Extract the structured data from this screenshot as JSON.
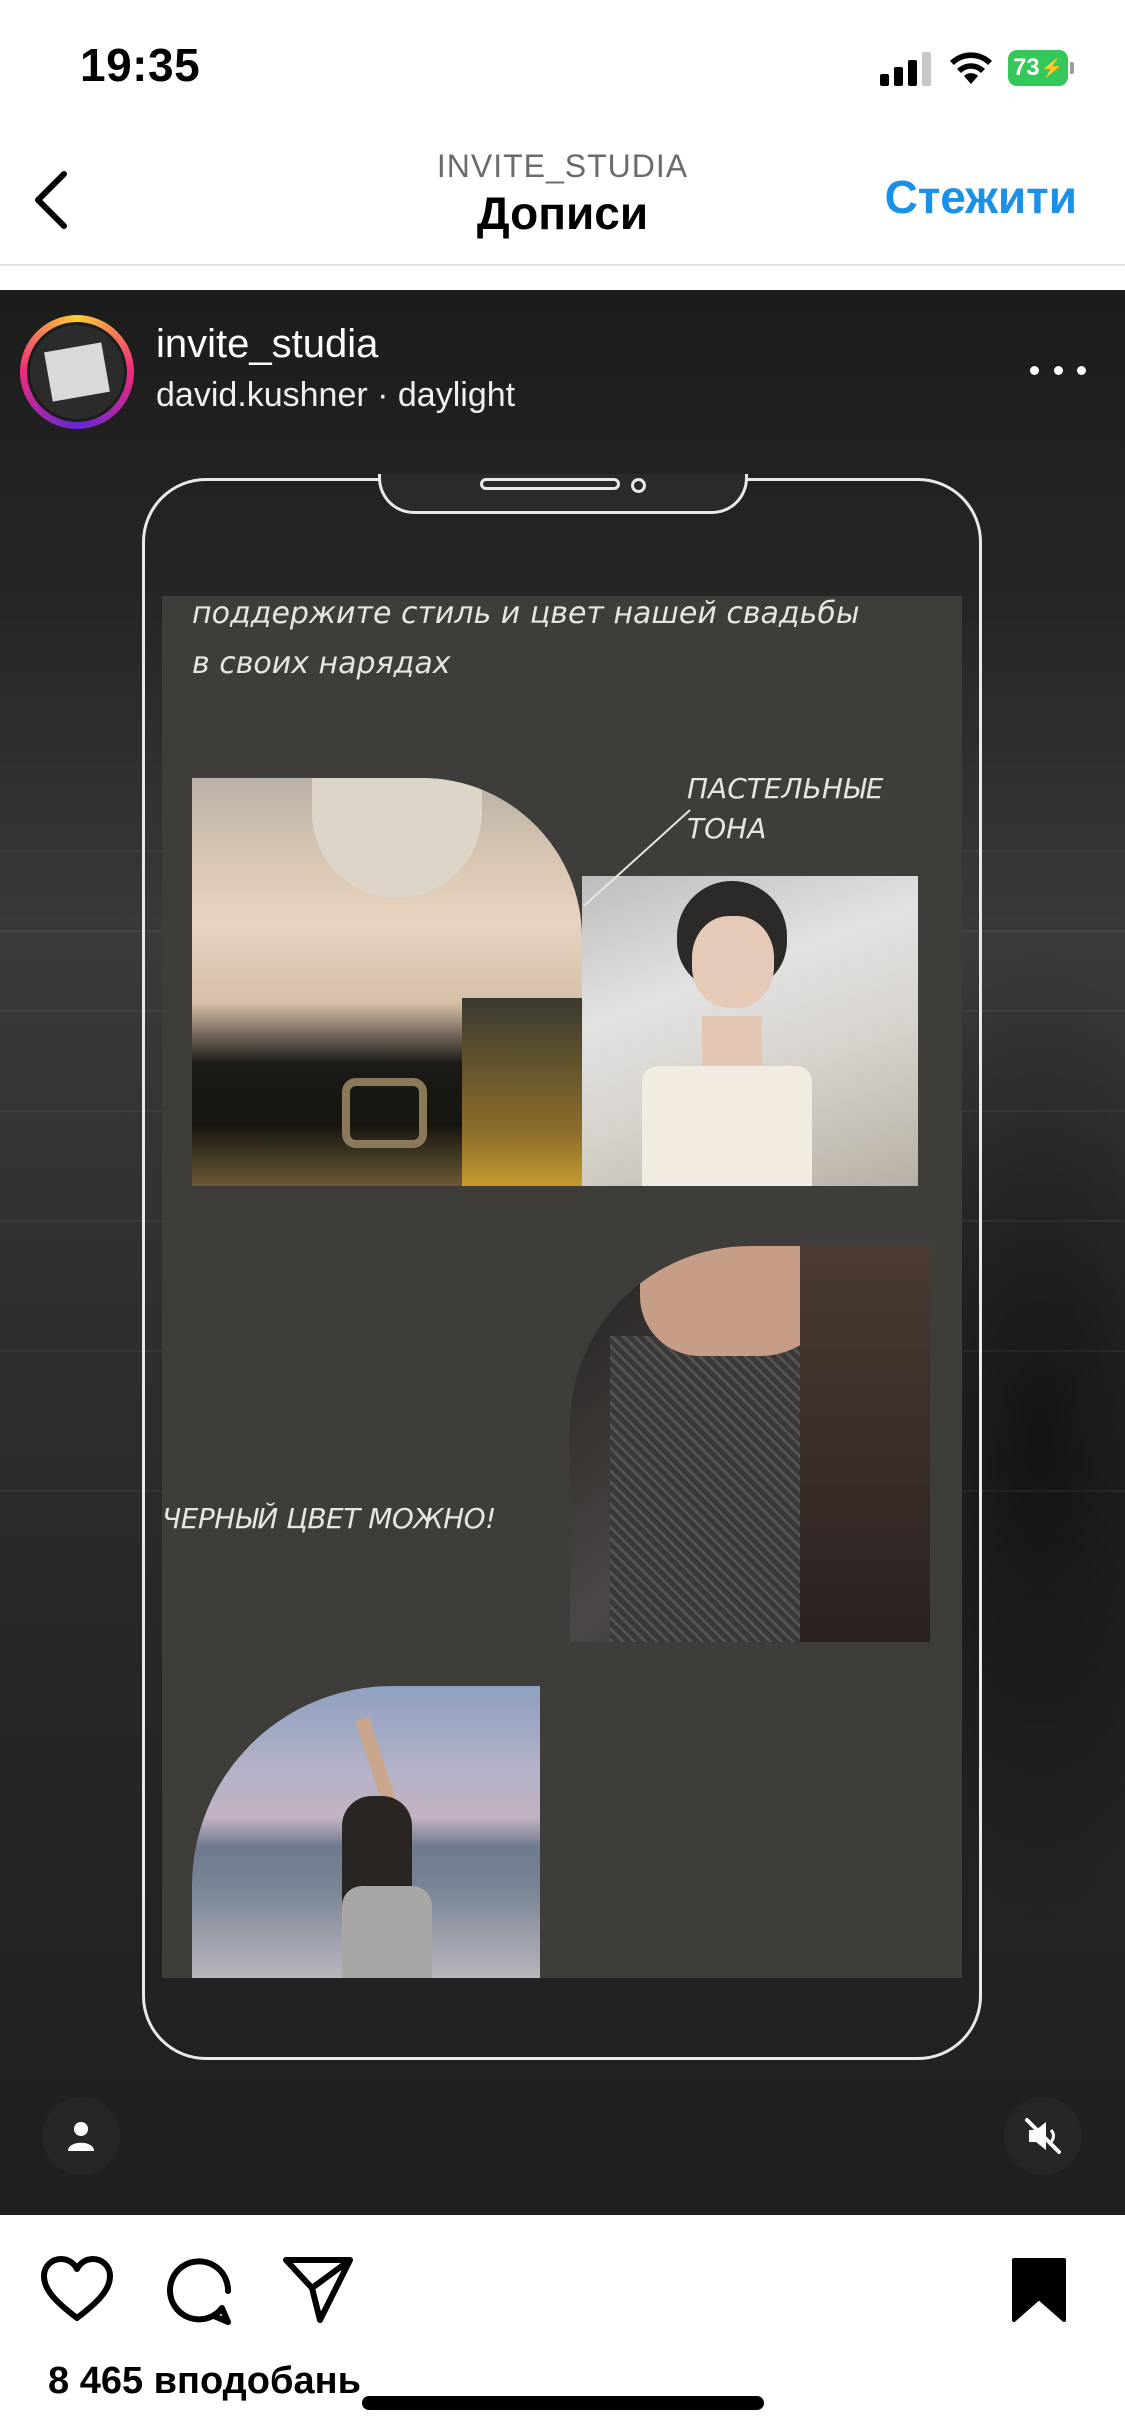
{
  "status_bar": {
    "time": "19:35",
    "battery": "73"
  },
  "nav": {
    "subtitle": "INVITE_STUDIA",
    "title": "Дописи",
    "follow_label": "Стежити"
  },
  "post": {
    "username": "invite_studia",
    "audio": "david.kushner · daylight",
    "likes": "8 465 вподобань"
  },
  "media": {
    "intro_line_1": "поддержите стиль и цвет нашей свадьбы",
    "intro_line_2": "в своих нарядах",
    "pastel_label_1": "ПАСТЕЛЬНЫЕ",
    "pastel_label_2": "ТОНА",
    "black_label": "ЧЕРНЫЙ ЦВЕТ МОЖНО!"
  },
  "colors": {
    "accent": "#1a90e8",
    "battery": "#34c759",
    "screen_bg": "#3e3d39"
  },
  "icons": [
    "chevron-left-icon",
    "signal-icon",
    "wifi-icon",
    "battery-icon",
    "more-icon",
    "person-icon",
    "mute-icon",
    "heart-icon",
    "comment-icon",
    "send-icon",
    "bookmark-icon"
  ]
}
